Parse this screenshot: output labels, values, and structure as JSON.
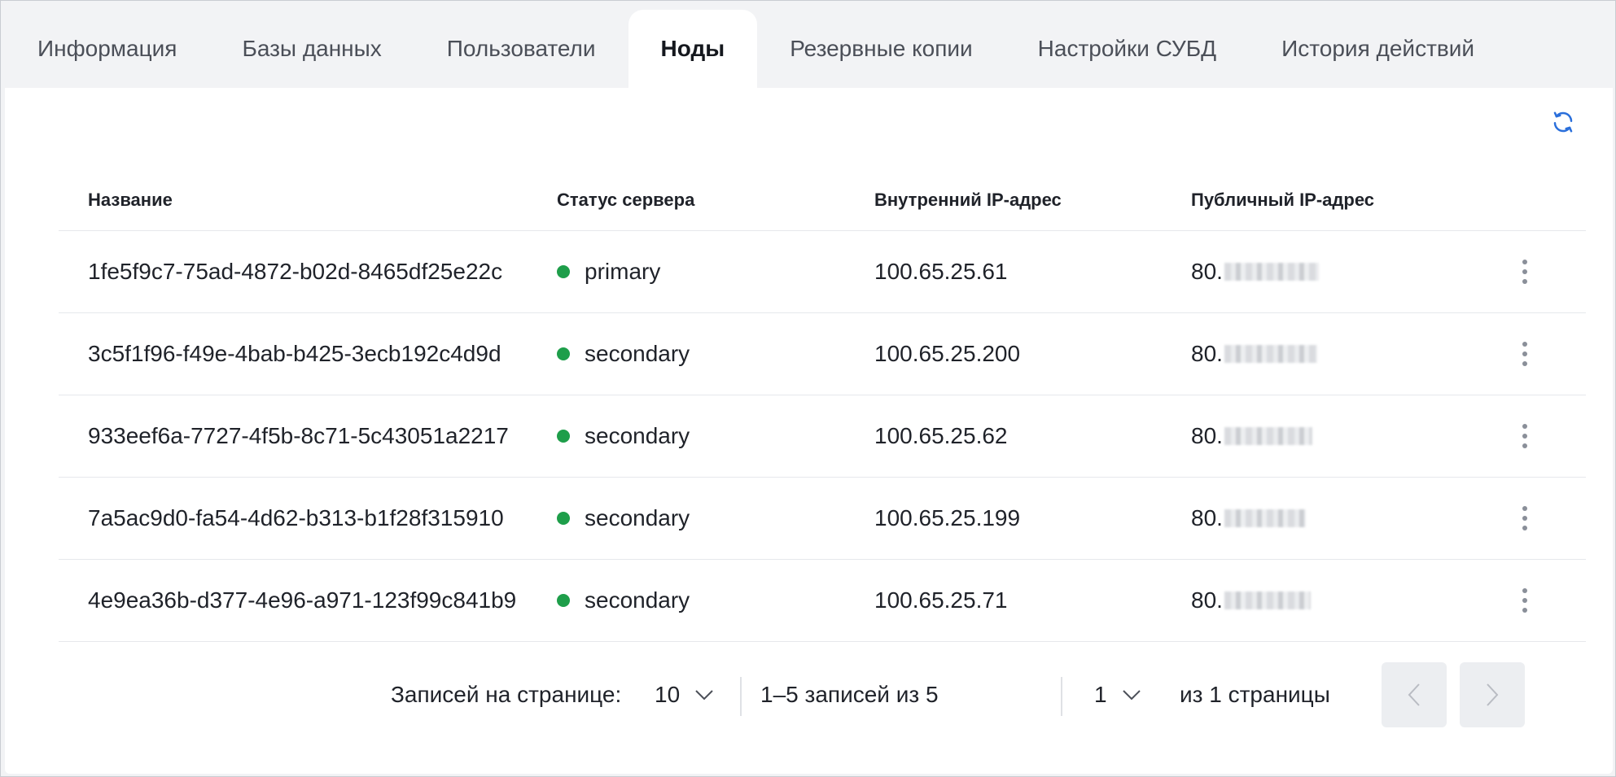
{
  "tabs": [
    {
      "label": "Информация",
      "active": false
    },
    {
      "label": "Базы данных",
      "active": false
    },
    {
      "label": "Пользователи",
      "active": false
    },
    {
      "label": "Ноды",
      "active": true
    },
    {
      "label": "Резервные копии",
      "active": false
    },
    {
      "label": "Настройки СУБД",
      "active": false
    },
    {
      "label": "История действий",
      "active": false
    }
  ],
  "refresh_icon": "refresh-icon",
  "table": {
    "headers": {
      "name": "Название",
      "status": "Статус сервера",
      "internal_ip": "Внутренний IP-адрес",
      "public_ip": "Публичный IP-адрес"
    },
    "rows": [
      {
        "name": "1fe5f9c7-75ad-4872-b02d-8465df25e22c",
        "status": "primary",
        "internal_ip": "100.65.25.61",
        "public_ip_prefix": "80."
      },
      {
        "name": "3c5f1f96-f49e-4bab-b425-3ecb192c4d9d",
        "status": "secondary",
        "internal_ip": "100.65.25.200",
        "public_ip_prefix": "80."
      },
      {
        "name": "933eef6a-7727-4f5b-8c71-5c43051a2217",
        "status": "secondary",
        "internal_ip": "100.65.25.62",
        "public_ip_prefix": "80."
      },
      {
        "name": "7a5ac9d0-fa54-4d62-b313-b1f28f315910",
        "status": "secondary",
        "internal_ip": "100.65.25.199",
        "public_ip_prefix": "80."
      },
      {
        "name": "4e9ea36b-d377-4e96-a971-123f99c841b9",
        "status": "secondary",
        "internal_ip": "100.65.25.71",
        "public_ip_prefix": "80."
      }
    ],
    "status_color": "#1e9e4a"
  },
  "pagination": {
    "per_page_label": "Записей на странице:",
    "per_page_value": "10",
    "range_text": "1–5 записей из 5",
    "page_value": "1",
    "pages_text": "из 1 страницы"
  },
  "colors": {
    "accent": "#2a6fdb",
    "background": "#f2f3f5"
  }
}
